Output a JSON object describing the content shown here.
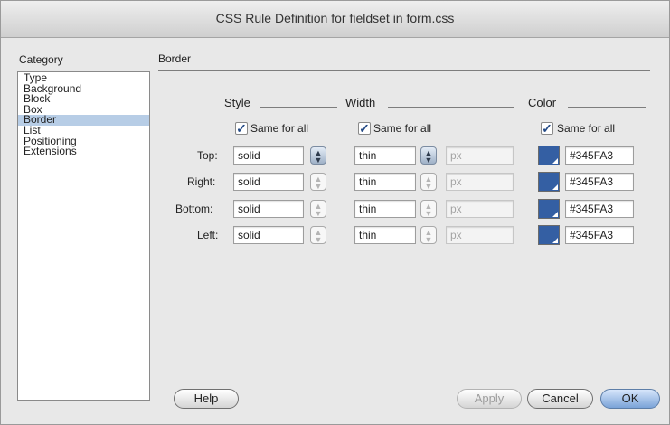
{
  "window": {
    "title": "CSS Rule Definition for fieldset in form.css"
  },
  "category": {
    "heading": "Category",
    "items": [
      "Type",
      "Background",
      "Block",
      "Box",
      "Border",
      "List",
      "Positioning",
      "Extensions"
    ],
    "selected": "Border"
  },
  "panel": {
    "heading": "Border"
  },
  "columns": {
    "style": "Style",
    "width": "Width",
    "color": "Color"
  },
  "same_for_all": {
    "label": "Same for all",
    "style_checked": true,
    "width_checked": true,
    "color_checked": true
  },
  "rows": [
    {
      "label": "Top:",
      "style": "solid",
      "width": "thin",
      "unit": "px",
      "color": "#345FA3"
    },
    {
      "label": "Right:",
      "style": "solid",
      "width": "thin",
      "unit": "px",
      "color": "#345FA3"
    },
    {
      "label": "Bottom:",
      "style": "solid",
      "width": "thin",
      "unit": "px",
      "color": "#345FA3"
    },
    {
      "label": "Left:",
      "style": "solid",
      "width": "thin",
      "unit": "px",
      "color": "#345FA3"
    }
  ],
  "buttons": {
    "help": "Help",
    "apply": "Apply",
    "cancel": "Cancel",
    "ok": "OK"
  },
  "icons": {
    "stepper": "stepper-arrows-icon",
    "check": "checkmark-icon",
    "swatch_menu": "color-swatch-icon"
  }
}
